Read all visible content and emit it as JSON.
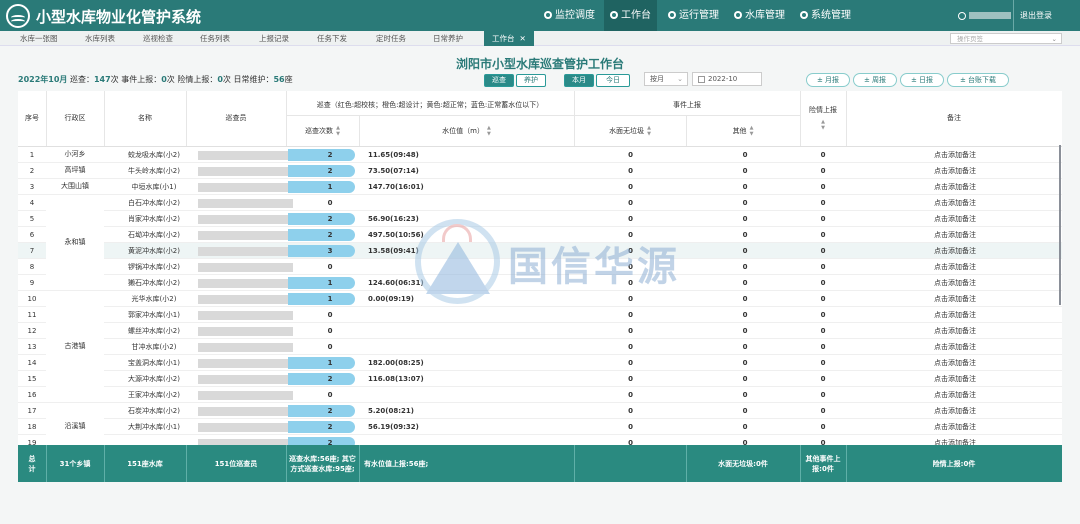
{
  "app_title": "小型水库物业化管护系统",
  "nav": [
    {
      "label": "监控调度",
      "icon": "monitor-icon"
    },
    {
      "label": "工作台",
      "icon": "workbench-icon"
    },
    {
      "label": "运行管理",
      "icon": "user-icon"
    },
    {
      "label": "水库管理",
      "icon": "reservoir-icon"
    },
    {
      "label": "系统管理",
      "icon": "gear-icon"
    }
  ],
  "logout": "退出登录",
  "tabs": [
    "水库一张图",
    "水库列表",
    "巡视检查",
    "任务列表",
    "上报记录",
    "任务下发",
    "定时任务",
    "日常养护",
    "工作台"
  ],
  "page_select_placeholder": "操作页签",
  "page_title": "浏阳市小型水库巡查管护工作台",
  "summary": {
    "month": "2022年10月",
    "patrol_label": "巡查：",
    "patrol_count": "147",
    "patrol_unit": "次 事件上报：",
    "event_count": "0",
    "event_unit": "次 险情上报：",
    "danger_count": "0",
    "danger_unit": "次 日常维护：",
    "maintain_count": "56",
    "maintain_unit": "座"
  },
  "toggle1": {
    "a": "巡查",
    "b": "养护"
  },
  "toggle2": {
    "a": "本月",
    "b": "今日"
  },
  "period_select": "按月",
  "date_value": "2022-10",
  "report_buttons": [
    "± 月报",
    "± 周报",
    "± 日报",
    "± 台账下载"
  ],
  "headers": {
    "idx": "序号",
    "district": "行政区",
    "name": "名称",
    "inspector": "巡查员",
    "patrol_group": "巡查（红色:超校核；橙色:超设计；黄色:超正常；蓝色:正常蓄水位以下）",
    "patrol_count": "巡查次数",
    "water_level": "水位值（m）",
    "event_group": "事件上报",
    "no_garbage": "水面无垃圾",
    "other": "其他",
    "danger": "险情上报",
    "note": "备注"
  },
  "note_text": "点击添加备注",
  "rows": [
    {
      "idx": "1",
      "name": "蛟龙吸水库(小2)",
      "count": "2",
      "level": "11.65(09:48)",
      "e1": "0",
      "e2": "0",
      "e3": "0"
    },
    {
      "idx": "2",
      "name": "牛头岭水库(小2)",
      "count": "2",
      "level": "73.50(07:14)",
      "e1": "0",
      "e2": "0",
      "e3": "0"
    },
    {
      "idx": "3",
      "name": "中垣水库(小1)",
      "count": "1",
      "level": "147.70(16:01)",
      "e1": "0",
      "e2": "0",
      "e3": "0"
    },
    {
      "idx": "4",
      "name": "白石冲水库(小2)",
      "count": "0",
      "level": "",
      "e1": "0",
      "e2": "0",
      "e3": "0"
    },
    {
      "idx": "5",
      "name": "肖家冲水库(小2)",
      "count": "2",
      "level": "56.90(16:23)",
      "e1": "0",
      "e2": "0",
      "e3": "0"
    },
    {
      "idx": "6",
      "name": "石坳冲水库(小2)",
      "count": "2",
      "level": "497.50(10:56)",
      "e1": "0",
      "e2": "0",
      "e3": "0"
    },
    {
      "idx": "7",
      "name": "黄泥冲水库(小2)",
      "count": "3",
      "level": "13.58(09:41)",
      "e1": "0",
      "e2": "0",
      "e3": "0"
    },
    {
      "idx": "8",
      "name": "锣锅冲水库(小2)",
      "count": "0",
      "level": "",
      "e1": "0",
      "e2": "0",
      "e3": "0"
    },
    {
      "idx": "9",
      "name": "獭石冲水库(小2)",
      "count": "1",
      "level": "124.60(06:31)",
      "e1": "0",
      "e2": "0",
      "e3": "0"
    },
    {
      "idx": "10",
      "name": "光华水库(小2)",
      "count": "1",
      "level": "0.00(09:19)",
      "e1": "0",
      "e2": "0",
      "e3": "0"
    },
    {
      "idx": "11",
      "name": "郭家冲水库(小1)",
      "count": "0",
      "level": "",
      "e1": "0",
      "e2": "0",
      "e3": "0"
    },
    {
      "idx": "12",
      "name": "螺丝冲水库(小2)",
      "count": "0",
      "level": "",
      "e1": "0",
      "e2": "0",
      "e3": "0"
    },
    {
      "idx": "13",
      "name": "甘冲水库(小2)",
      "count": "0",
      "level": "",
      "e1": "0",
      "e2": "0",
      "e3": "0"
    },
    {
      "idx": "14",
      "name": "宝盖洞水库(小1)",
      "count": "1",
      "level": "182.00(08:25)",
      "e1": "0",
      "e2": "0",
      "e3": "0"
    },
    {
      "idx": "15",
      "name": "大源冲水库(小2)",
      "count": "2",
      "level": "116.08(13:07)",
      "e1": "0",
      "e2": "0",
      "e3": "0"
    },
    {
      "idx": "16",
      "name": "王家冲水库(小2)",
      "count": "0",
      "level": "",
      "e1": "0",
      "e2": "0",
      "e3": "0"
    },
    {
      "idx": "17",
      "name": "石炭冲水库(小2)",
      "count": "2",
      "level": "5.20(08:21)",
      "e1": "0",
      "e2": "0",
      "e3": "0"
    },
    {
      "idx": "18",
      "name": "大荆冲水库(小1)",
      "count": "2",
      "level": "56.19(09:32)",
      "e1": "0",
      "e2": "0",
      "e3": "0"
    },
    {
      "idx": "19",
      "name": "",
      "count": "2",
      "level": "",
      "e1": "0",
      "e2": "0",
      "e3": "0"
    }
  ],
  "districts": [
    "小河乡",
    "高坪镇",
    "大围山镇",
    "永和镇",
    "古港镇",
    "沿溪镇"
  ],
  "footer": {
    "total": "总\n计",
    "towns": "31个乡镇",
    "reservoirs": "151座水库",
    "inspectors": "151位巡查员",
    "patrol": "巡查水库:56座; 其它方式巡查水库:95座;",
    "level": "有水位值上报:56座;",
    "no_garbage": "水面无垃圾:0件",
    "other": "其他事件上报:0件",
    "danger": "险情上报:0件"
  },
  "watermark": "国信华源",
  "colors": {
    "primary": "#2a7a78",
    "pill": "#8ed0ec",
    "footer": "#2a8a80"
  }
}
